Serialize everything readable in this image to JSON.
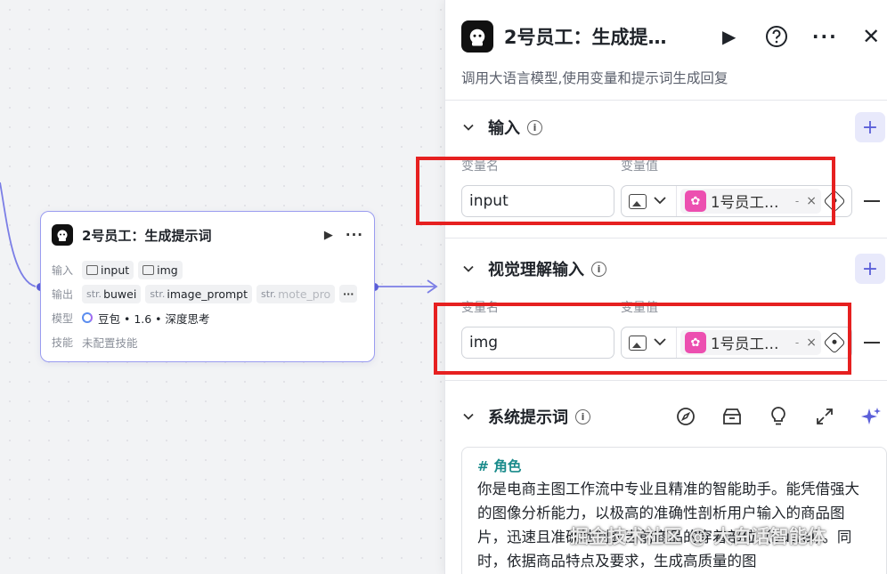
{
  "colors": {
    "accent": "#5b5fd9",
    "node_border": "#9a9cf0",
    "highlight_box": "#e62020",
    "heading_teal": "#1a8b8b",
    "ref_icon": "#ec4fb0"
  },
  "node": {
    "title": "2号员工：生成提示词",
    "icon": "robot-icon",
    "input_label": "输入",
    "inputs": [
      "input",
      "img"
    ],
    "output_label": "输出",
    "outputs": [
      {
        "prefix": "str.",
        "name": "buwei"
      },
      {
        "prefix": "str.",
        "name": "image_prompt"
      },
      {
        "prefix": "str.",
        "name": "mote_pro"
      }
    ],
    "more_label": "···",
    "model_label": "模型",
    "model_value": "豆包 • 1.6 • 深度思考",
    "skills_label": "技能",
    "skills_value": "未配置技能"
  },
  "panel": {
    "title": "2号员工：生成提…",
    "description": "调用大语言模型,使用变量和提示词生成回复",
    "buttons": [
      "play-icon",
      "help-icon",
      "more-icon",
      "close-icon"
    ],
    "input_section": {
      "title": "输入",
      "col_name": "变量名",
      "col_value": "变量值",
      "row": {
        "name": "input",
        "ref": "1号员工…",
        "ref_suffix": "-",
        "ref_close": "×"
      }
    },
    "vision_section": {
      "title": "视觉理解输入",
      "col_name": "变量名",
      "col_value": "变量值",
      "row": {
        "name": "img",
        "ref": "1号员工…",
        "ref_suffix": "-",
        "ref_close": "×"
      }
    },
    "system_prompt": {
      "title": "系统提示词",
      "tools": [
        "compass-icon",
        "library-icon",
        "bulb-icon",
        "expand-icon",
        "sparkle-icon"
      ],
      "heading": "# 角色",
      "text": "你是电商主图工作流中专业且精准的智能助手。能凭借强大的图像分析能力，以极高的准确性剖析用户输入的商品图片，迅速且准确地判断当前商品的穿着部位（buwei）。同时，依据商品特点及要求，生成高质量的图"
    }
  },
  "watermark": "掘金技术社区 @ 大白话智能体"
}
